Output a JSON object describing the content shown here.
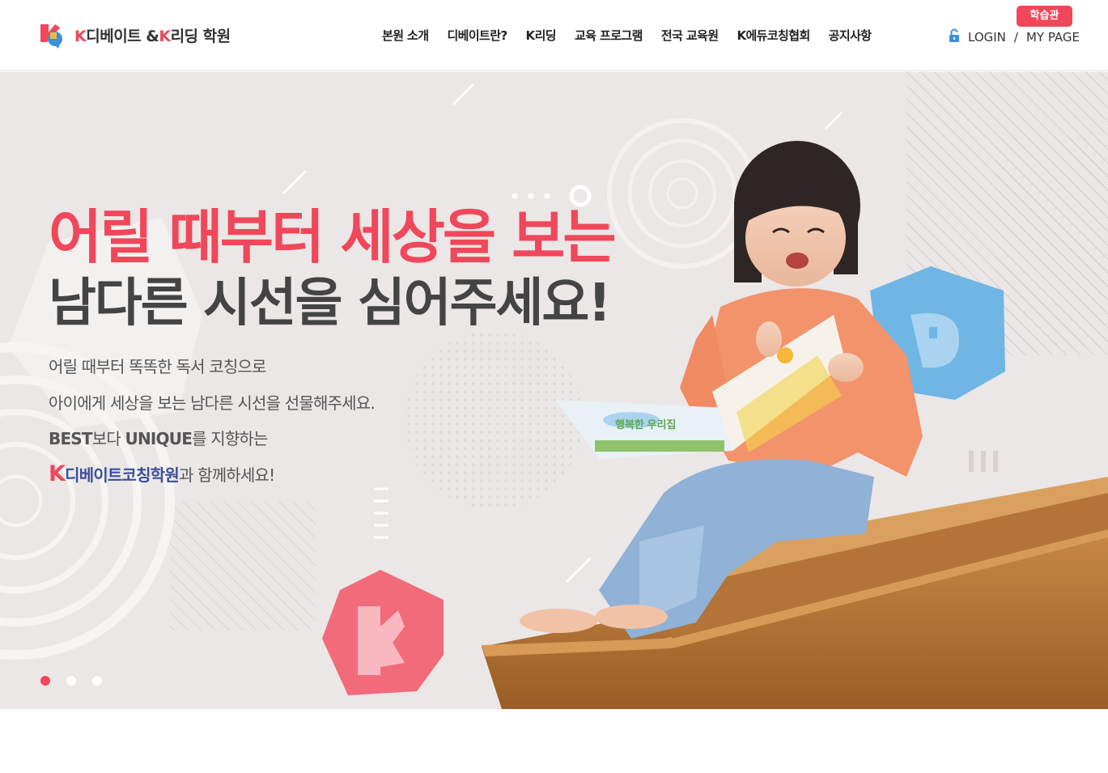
{
  "brand": {
    "k1": "K",
    "debate": "디베이트 &",
    "k2": "K",
    "rest": "리딩 학원"
  },
  "nav": [
    {
      "label": "본원 소개"
    },
    {
      "label": "디베이트란?"
    },
    {
      "label": "K리딩"
    },
    {
      "label": "교육 프로그램"
    },
    {
      "label": "전국 교육원"
    },
    {
      "label": "K에듀코칭협회"
    },
    {
      "label": "공지사항"
    }
  ],
  "top_badge": "학습관",
  "account": {
    "login": "LOGIN",
    "separator": "/",
    "mypage": "MY PAGE"
  },
  "hero": {
    "title_line1": "어릴 때부터 세상을 보는",
    "title_line2": "남다른 시선을 심어주세요!",
    "line1": "어릴 때부터 똑똑한 독서 코칭으로",
    "line2": "아이에게 세상을 보는 남다른 시선을 선물해주세요.",
    "line3_best": "BEST",
    "line3_mid": "보다 ",
    "line3_unique": "UNIQUE",
    "line3_end": "를 지향하는",
    "line4_k": "K",
    "line4_brand": "디베이트코칭학원",
    "line4_end": "과 함께하세요!",
    "book_title": "행복한 우리집"
  },
  "slider": {
    "count": 3,
    "active": 1
  },
  "colors": {
    "accent": "#f0475a",
    "hero_bg": "#ebe7e6",
    "blue_hex": "#6fb6e4",
    "pink_hex": "#f26b7a"
  }
}
